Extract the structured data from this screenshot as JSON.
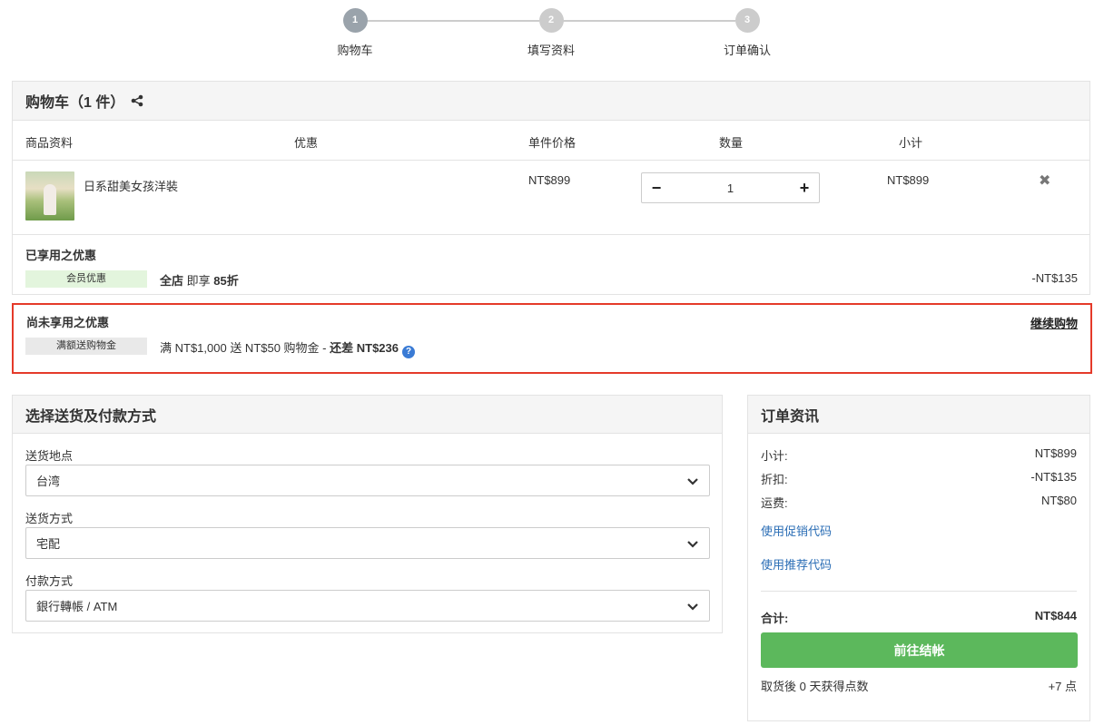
{
  "steps": [
    {
      "num": "1",
      "label": "购物车"
    },
    {
      "num": "2",
      "label": "填写资料"
    },
    {
      "num": "3",
      "label": "订单确认"
    }
  ],
  "cart": {
    "title": "购物车（1 件）",
    "columns": {
      "product": "商品资料",
      "discount": "优惠",
      "unit_price": "单件价格",
      "qty": "数量",
      "subtotal": "小计"
    },
    "item": {
      "name": "日系甜美女孩洋裝",
      "price": "NT$899",
      "quantity": "1",
      "subtotal": "NT$899"
    },
    "applied": {
      "title": "已享用之优惠",
      "tag": "会员优惠",
      "text_a": "全店",
      "text_b": "即享",
      "text_c": "85折",
      "amount": "-NT$135"
    }
  },
  "unused": {
    "title": "尚未享用之优惠",
    "continue_label": "继续购物",
    "tag": "满额送购物金",
    "text": "满 NT$1,000 送 NT$50 购物金 - ",
    "text_bold": "还差 NT$236",
    "help": "?"
  },
  "shipping": {
    "title": "选择送货及付款方式",
    "location_label": "送货地点",
    "location_value": "台湾",
    "method_label": "送货方式",
    "method_value": "宅配",
    "payment_label": "付款方式",
    "payment_value": "銀行轉帳 / ATM"
  },
  "order": {
    "title": "订单资讯",
    "subtotal_label": "小计:",
    "subtotal_value": "NT$899",
    "discount_label": "折扣:",
    "discount_value": "-NT$135",
    "shipping_label": "运费:",
    "shipping_value": "NT$80",
    "promo_link": "使用促销代码",
    "referral_link": "使用推荐代码",
    "total_label": "合计:",
    "total_value": "NT$844",
    "checkout_label": "前往结帐",
    "points_label": "取货後 0 天获得点数",
    "points_value": "+7 点"
  },
  "colors": {
    "accent_green": "#5cb85c",
    "highlight_red": "#e53a2a",
    "link_blue": "#2a6db5"
  }
}
